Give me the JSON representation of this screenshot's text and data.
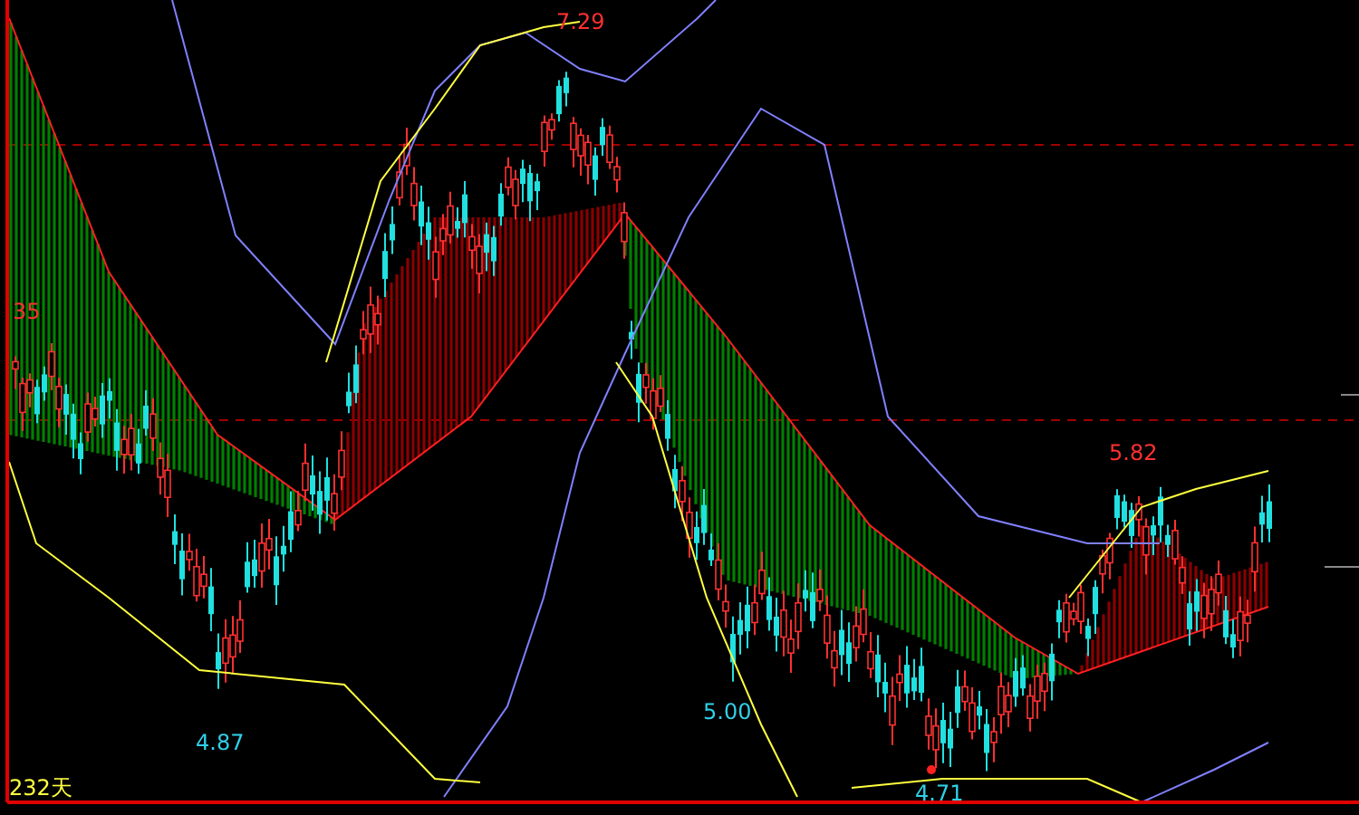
{
  "chart": {
    "price_labels": [
      {
        "text": "7.29",
        "kind": "high"
      },
      {
        "text": "35",
        "kind": "axis"
      },
      {
        "text": "5.82",
        "kind": "high"
      },
      {
        "text": "4.87",
        "kind": "low"
      },
      {
        "text": "5.00",
        "kind": "low"
      },
      {
        "text": "4.71",
        "kind": "low"
      }
    ],
    "period": "232天"
  }
}
